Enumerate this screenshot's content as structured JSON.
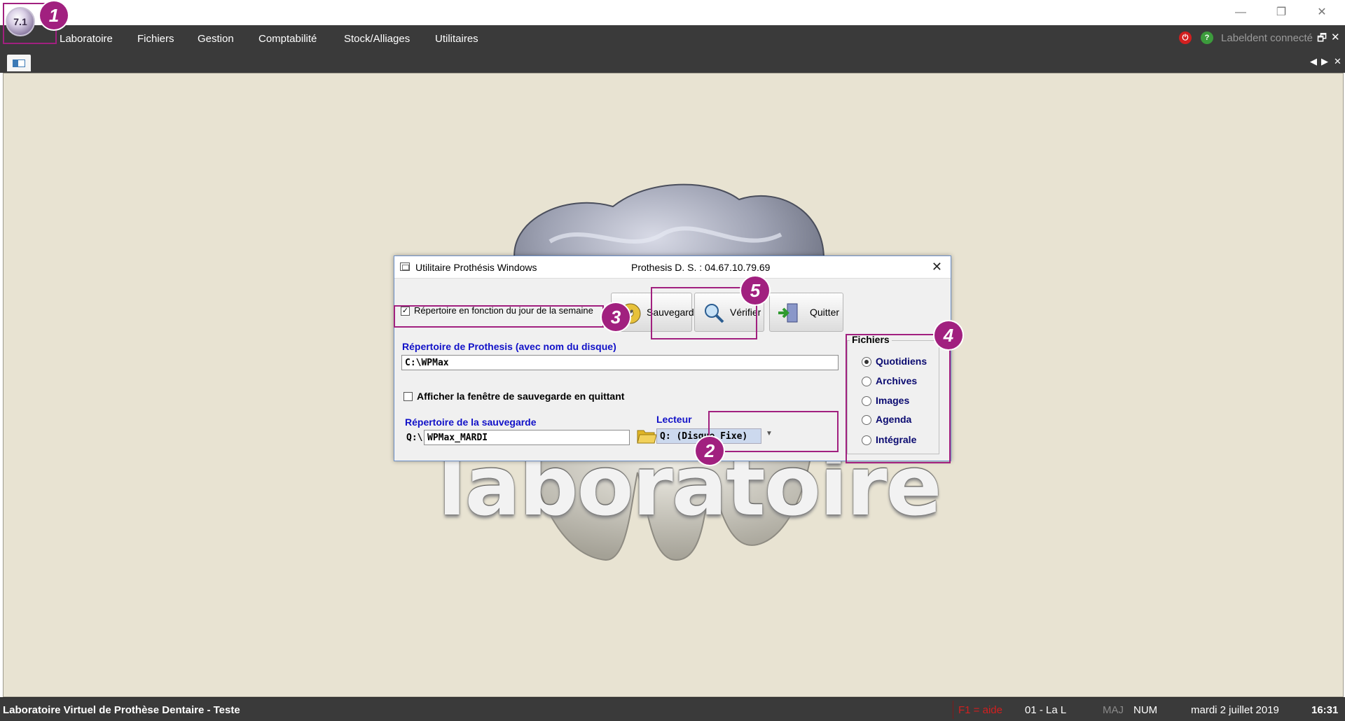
{
  "app": {
    "icon_label": "7.1",
    "window_controls": {
      "minimize": "—",
      "restore": "❐",
      "close": "✕"
    }
  },
  "menu": {
    "items": [
      "Laboratoire",
      "Fichiers",
      "Gestion",
      "Comptabilité",
      "Stock/Alliages",
      "Utilitaires"
    ],
    "connection_status": "Labeldent connecté",
    "restore_icon": "🗗",
    "close_icon": "✕"
  },
  "tabstrip": {
    "prev": "◀",
    "next": "▶",
    "close": "✕"
  },
  "background": {
    "watermark_word": "laboratoire"
  },
  "dialog": {
    "title": "Utilitaire Prothésis Windows",
    "subtitle": "Prothesis D. S. : 04.67.10.79.69",
    "close": "✕",
    "checkbox_weekday": {
      "label": "Répertoire en fonction du jour de la semaine",
      "checked": true,
      "mark": "✓"
    },
    "prothesis_dir": {
      "label": "Répertoire de Prothesis (avec nom du disque)",
      "value": "C:\\WPMax"
    },
    "checkbox_show": {
      "label": "Afficher la fenêtre de sauvegarde en quittant",
      "checked": false
    },
    "backup_dir": {
      "label": "Répertoire de la sauvegarde",
      "drive_prefix": "Q:\\",
      "value": "WPMax_MARDI"
    },
    "drive": {
      "label": "Lecteur",
      "value": "Q: (Disque Fixe)"
    },
    "buttons": {
      "save": "Sauvegarde",
      "verify": "Vérifier",
      "quit": "Quitter"
    },
    "files_group": {
      "title": "Fichiers",
      "options": [
        "Quotidiens",
        "Archives",
        "Images",
        "Agenda",
        "Intégrale"
      ],
      "selected": "Quotidiens"
    }
  },
  "annotations": [
    "1",
    "2",
    "3",
    "4",
    "5"
  ],
  "statusbar": {
    "title": "Laboratoire Virtuel de Prothèse Dentaire - Teste",
    "help": "F1 = aide",
    "lab": "01 - La L",
    "caps": "MAJ",
    "num": "NUM",
    "date": "mardi 2 juillet 2019",
    "time": "16:31"
  },
  "colors": {
    "highlight": "#a1207f",
    "menubar": "#3a3a3a",
    "workspace": "#e8e3d2",
    "label_blue": "#1111c8"
  }
}
